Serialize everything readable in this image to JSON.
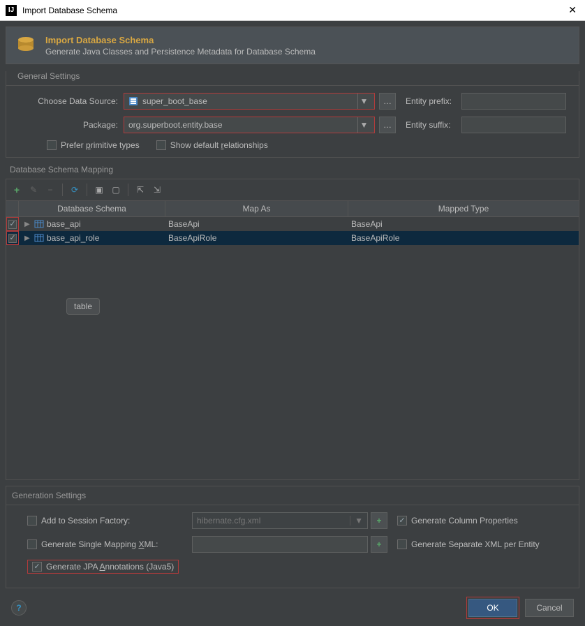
{
  "window": {
    "title": "Import Database Schema"
  },
  "banner": {
    "title": "Import Database Schema",
    "subtitle": "Generate Java Classes and Persistence Metadata for Database Schema"
  },
  "general": {
    "section_label": "General Settings",
    "data_source_label": "Choose Data Source:",
    "data_source_value": "super_boot_base",
    "package_label": "Package:",
    "package_value": "org.superboot.entity.base",
    "entity_prefix_label": "Entity prefix:",
    "entity_prefix_value": "",
    "entity_suffix_label": "Entity suffix:",
    "entity_suffix_value": "",
    "prefer_primitive_label_pre": "Prefer ",
    "prefer_primitive_label_ul": "p",
    "prefer_primitive_label_post": "rimitive types",
    "show_default_label_pre": "Show default ",
    "show_default_label_ul": "r",
    "show_default_label_post": "elationships"
  },
  "mapping": {
    "section_label": "Database Schema Mapping",
    "headers": {
      "c1": "Database Schema",
      "c2": "Map As",
      "c3": "Mapped Type"
    },
    "rows": [
      {
        "name": "base_api",
        "mapAs": "BaseApi",
        "mappedType": "BaseApi",
        "selected": false
      },
      {
        "name": "base_api_role",
        "mapAs": "BaseApiRole",
        "mappedType": "BaseApiRole",
        "selected": true
      }
    ],
    "tooltip": "table"
  },
  "generation": {
    "section_label": "Generation Settings",
    "add_session_label": "Add to Session Factory:",
    "hibernate_placeholder": "hibernate.cfg.xml",
    "gen_column_props_label": "Generate Column Properties",
    "single_mapping_label_pre": "Generate Single Mapping ",
    "single_mapping_label_ul": "X",
    "single_mapping_label_post": "ML:",
    "single_mapping_value": "",
    "separate_xml_label": "Generate Separate XML per Entity",
    "jpa_label_pre": "Generate JPA ",
    "jpa_label_ul": "A",
    "jpa_label_post": "nnotations (Java5)"
  },
  "footer": {
    "ok": "OK",
    "cancel": "Cancel"
  }
}
